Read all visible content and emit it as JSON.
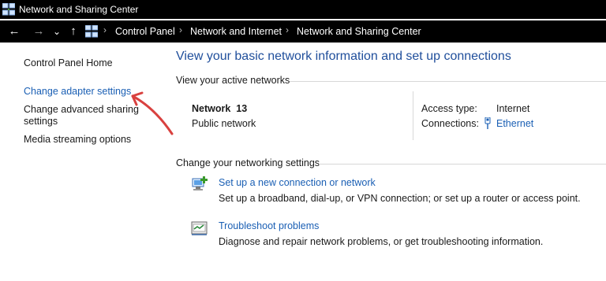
{
  "window": {
    "title": "Network and Sharing Center"
  },
  "address_bar": {
    "back_label": "←",
    "forward_label": "→",
    "recent_label": "⌄",
    "up_label": "↑",
    "crumbs": [
      "Control Panel",
      "Network and Internet",
      "Network and Sharing Center"
    ]
  },
  "sidebar": {
    "items": [
      {
        "label": "Control Panel Home"
      },
      {
        "label": "Change adapter settings"
      },
      {
        "label": "Change advanced sharing settings"
      },
      {
        "label": "Media streaming options"
      }
    ]
  },
  "main": {
    "heading": "View your basic network information and set up connections",
    "active_networks_label": "View your active networks",
    "network": {
      "name": "Network  13",
      "type": "Public network",
      "access_type_label": "Access type:",
      "access_type_value": "Internet",
      "connections_label": "Connections:",
      "connections_value": "Ethernet"
    },
    "change_settings_label": "Change your networking settings",
    "tasks": [
      {
        "title": "Set up a new connection or network",
        "description": "Set up a broadband, dial-up, or VPN connection; or set up a router or access point.",
        "icon": "network-setup-icon"
      },
      {
        "title": "Troubleshoot problems",
        "description": "Diagnose and repair network problems, or get troubleshooting information.",
        "icon": "troubleshoot-icon"
      }
    ]
  },
  "colors": {
    "link": "#1a5fb4",
    "heading": "#1f4e9b",
    "annotation_arrow": "#d9413f",
    "titlebar": "#000000"
  }
}
